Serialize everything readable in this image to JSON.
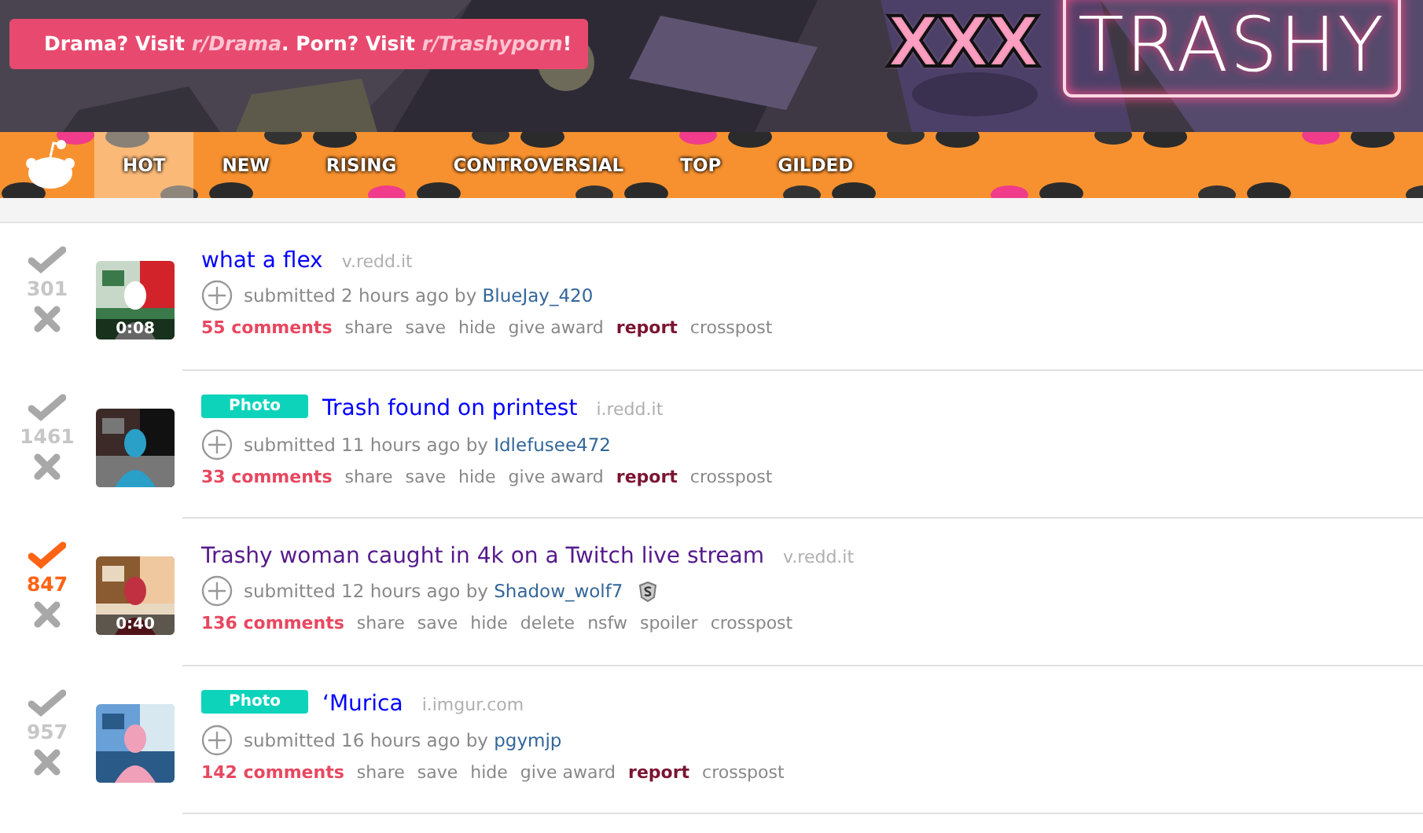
{
  "header": {
    "banner": [
      {
        "kind": "text",
        "text": "Drama? Visit "
      },
      {
        "kind": "link",
        "text": "r/Drama"
      },
      {
        "kind": "text",
        "text": ". Porn? Visit "
      },
      {
        "kind": "link",
        "text": "r/Trashyporn"
      },
      {
        "kind": "text",
        "text": "!"
      }
    ],
    "logo_left": "XXX",
    "logo_right": "TRASHY"
  },
  "tabs": [
    {
      "label": "HOT",
      "selected": true
    },
    {
      "label": "NEW",
      "selected": false
    },
    {
      "label": "RISING",
      "selected": false
    },
    {
      "label": "CONTROVERSIAL",
      "selected": false
    },
    {
      "label": "TOP",
      "selected": false
    },
    {
      "label": "GILDED",
      "selected": false
    }
  ],
  "posts": [
    {
      "score": "301",
      "upvoted": false,
      "thumbnail": {
        "kind": "picture",
        "duration": "0:08"
      },
      "title": "what a flex",
      "visited": false,
      "domain": "v.redd.it",
      "submitted": "submitted 2 hours ago by",
      "author": "BlueJay_420",
      "actions": [
        {
          "kind": "comments",
          "label": "55 comments"
        },
        {
          "kind": "plain",
          "label": "share"
        },
        {
          "kind": "plain",
          "label": "save"
        },
        {
          "kind": "plain",
          "label": "hide"
        },
        {
          "kind": "plain",
          "label": "give award"
        },
        {
          "kind": "report",
          "label": "report"
        },
        {
          "kind": "plain",
          "label": "crosspost"
        }
      ]
    },
    {
      "score": "1461",
      "upvoted": false,
      "thumbnail": {
        "kind": "picture"
      },
      "flair": "Photo",
      "title": "Trash found on printest",
      "visited": false,
      "domain": "i.redd.it",
      "submitted": "submitted 11 hours ago by",
      "author": "Idlefusee472",
      "actions": [
        {
          "kind": "comments",
          "label": "33 comments"
        },
        {
          "kind": "plain",
          "label": "share"
        },
        {
          "kind": "plain",
          "label": "save"
        },
        {
          "kind": "plain",
          "label": "hide"
        },
        {
          "kind": "plain",
          "label": "give award"
        },
        {
          "kind": "report",
          "label": "report"
        },
        {
          "kind": "plain",
          "label": "crosspost"
        }
      ]
    },
    {
      "score": "847",
      "upvoted": true,
      "thumbnail": {
        "kind": "picture",
        "duration": "0:40"
      },
      "title": "Trashy woman caught in 4k on a Twitch live stream",
      "visited": true,
      "domain": "v.redd.it",
      "submitted": "submitted 12 hours ago by",
      "author": "Shadow_wolf7",
      "author_badge": true,
      "actions": [
        {
          "kind": "comments",
          "label": "136 comments"
        },
        {
          "kind": "plain",
          "label": "share"
        },
        {
          "kind": "plain",
          "label": "save"
        },
        {
          "kind": "plain",
          "label": "hide"
        },
        {
          "kind": "plain",
          "label": "delete"
        },
        {
          "kind": "plain",
          "label": "nsfw"
        },
        {
          "kind": "plain",
          "label": "spoiler"
        },
        {
          "kind": "plain",
          "label": "crosspost"
        }
      ]
    },
    {
      "score": "957",
      "upvoted": false,
      "thumbnail": {
        "kind": "picture"
      },
      "flair": "Photo",
      "title": "‘Murica",
      "visited": false,
      "domain": "i.imgur.com",
      "submitted": "submitted 16 hours ago by",
      "author": "pgymjp",
      "actions": [
        {
          "kind": "comments",
          "label": "142 comments"
        },
        {
          "kind": "plain",
          "label": "share"
        },
        {
          "kind": "plain",
          "label": "save"
        },
        {
          "kind": "plain",
          "label": "hide"
        },
        {
          "kind": "plain",
          "label": "give award"
        },
        {
          "kind": "report",
          "label": "report"
        },
        {
          "kind": "plain",
          "label": "crosspost"
        }
      ]
    }
  ]
}
